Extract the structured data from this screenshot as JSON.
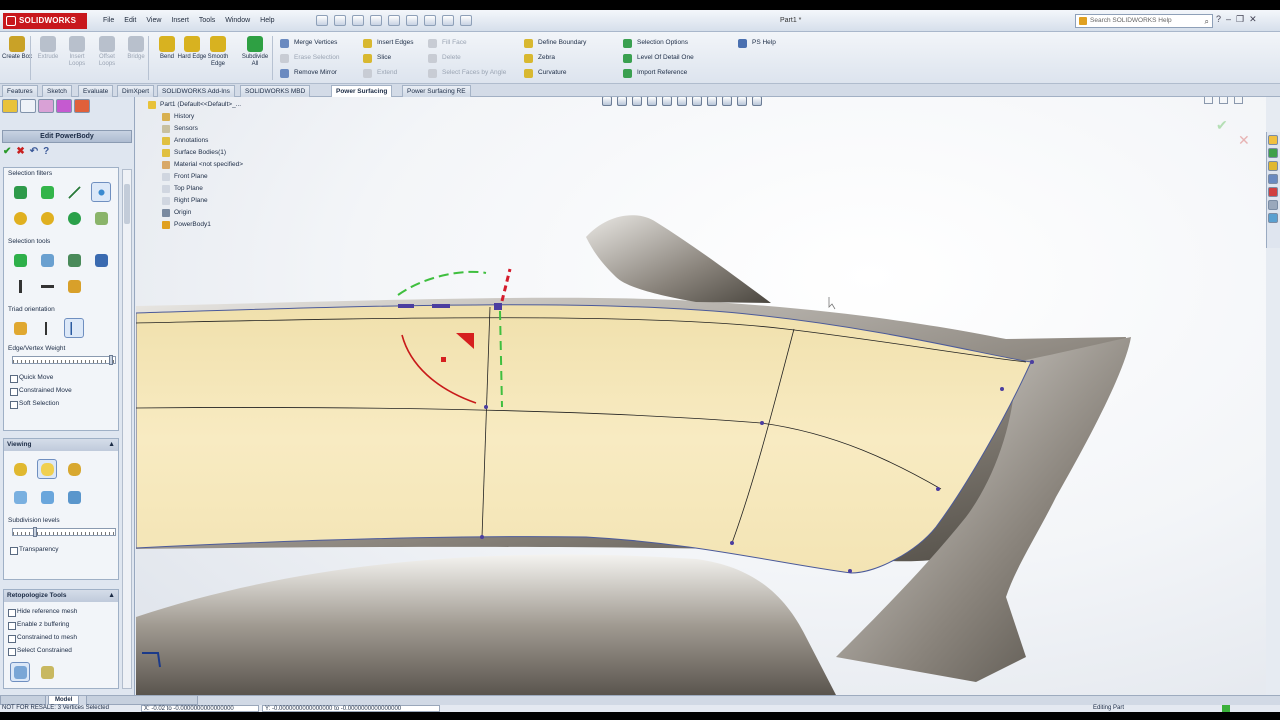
{
  "app": {
    "brand": "SOLIDWORKS",
    "doc_title": "Part1 *",
    "menus": [
      "File",
      "Edit",
      "View",
      "Insert",
      "Tools",
      "Window",
      "Help"
    ],
    "search_placeholder": "Search SOLIDWORKS Help"
  },
  "ribbon": {
    "large": [
      {
        "label": "Create Box",
        "color": "#c9a227",
        "disabled": false
      },
      {
        "label": "Extrude",
        "color": "#b8c0cc",
        "disabled": true
      },
      {
        "label": "Insert Loops",
        "color": "#b8c0cc",
        "disabled": true
      },
      {
        "label": "Offset Loops",
        "color": "#b8c0cc",
        "disabled": true
      },
      {
        "label": "Bridge",
        "color": "#b8c0cc",
        "disabled": true
      },
      {
        "label": "Bend",
        "color": "#d8b220",
        "disabled": false
      },
      {
        "label": "Hard Edge",
        "color": "#d8b220",
        "disabled": false
      },
      {
        "label": "Smooth Edge",
        "color": "#d8b220",
        "disabled": false
      },
      {
        "label": "Subdivide All",
        "color": "#2ea043",
        "disabled": false
      }
    ],
    "col1": [
      {
        "label": "Merge Vertices",
        "disabled": false
      },
      {
        "label": "Erase Selection",
        "disabled": true
      },
      {
        "label": "Remove Mirror",
        "disabled": false
      }
    ],
    "col2": [
      {
        "label": "Insert Edges",
        "disabled": false
      },
      {
        "label": "Slice",
        "disabled": false
      },
      {
        "label": "Extend",
        "disabled": true
      }
    ],
    "col3": [
      {
        "label": "Fill Face",
        "disabled": true
      },
      {
        "label": "Delete",
        "disabled": true
      },
      {
        "label": "Select Faces by Angle",
        "disabled": true
      }
    ],
    "col4": [
      {
        "label": "Define Boundary",
        "disabled": false
      },
      {
        "label": "Zebra",
        "disabled": false
      },
      {
        "label": "Curvature",
        "disabled": false
      }
    ],
    "col5": [
      {
        "label": "Selection Options",
        "disabled": false
      },
      {
        "label": "Level Of Detail One",
        "disabled": false
      },
      {
        "label": "Import Reference",
        "disabled": false
      }
    ],
    "col6": [
      {
        "label": "PS Help",
        "disabled": false
      }
    ]
  },
  "tabs": [
    "Features",
    "Sketch",
    "Evaluate",
    "DimXpert",
    "SOLIDWORKS Add-Ins",
    "SOLIDWORKS MBD",
    "Power Surfacing",
    "Power Surfacing RE"
  ],
  "active_tab": "Power Surfacing",
  "property_manager": {
    "title": "Edit PowerBody",
    "selection_filters": "Selection filters",
    "selection_tools": "Selection tools",
    "triad_orientation": "Triad orientation",
    "edge_vertex_weight": "Edge/Vertex Weight",
    "options": [
      "Quick Move",
      "Constrained Move",
      "Soft Selection"
    ],
    "viewing": "Viewing",
    "subdivision_levels": "Subdivision levels",
    "transparency": "Transparency",
    "retopo_title": "Retopologize Tools",
    "retopo_options": [
      "Hide reference mesh",
      "Enable z buffering",
      "Constrained to mesh",
      "Select Constrained"
    ]
  },
  "feature_tree": {
    "root": "Part1  (Default<<Default>_...",
    "items": [
      "History",
      "Sensors",
      "Annotations",
      "Surface Bodies(1)",
      "Material <not specified>",
      "Front Plane",
      "Top Plane",
      "Right Plane",
      "Origin",
      "PowerBody1"
    ]
  },
  "bottom_tabs": [
    "Model"
  ],
  "status": {
    "left": "NOT FOR RESALE: 3 Vertices Selected",
    "x": "X: -0.02 to -0.0000000000000000",
    "y": "Y: -0.0000000000000000 to -0.0000000000000000",
    "right": "Editing Part"
  }
}
